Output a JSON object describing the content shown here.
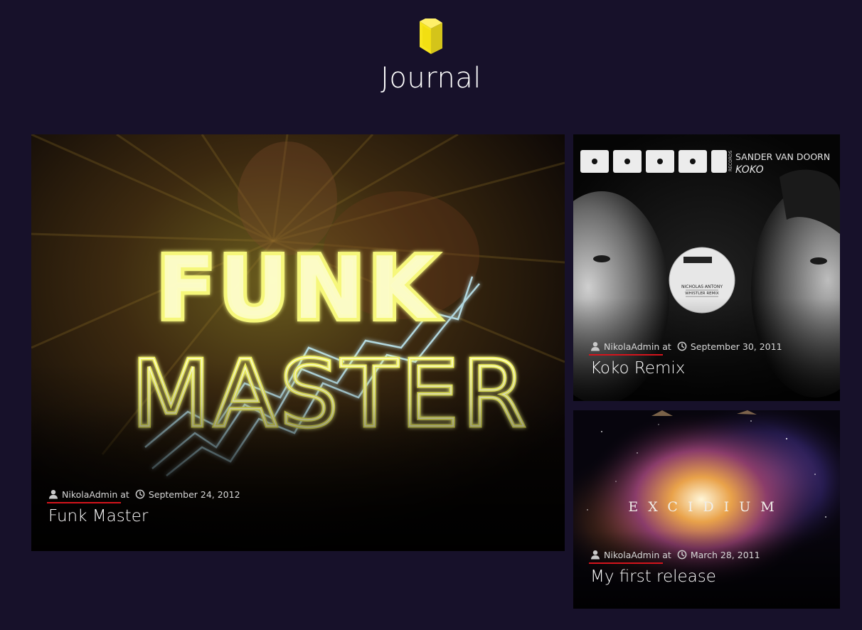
{
  "header": {
    "title": "Journal",
    "icon": "book-icon",
    "icon_color": "#f7e51d"
  },
  "posts": [
    {
      "title": "Funk Master",
      "author": "NikolaAdmin",
      "at_word": "at",
      "date": "September 24, 2012",
      "artwork_text": [
        "FUNK",
        "MASTER"
      ]
    },
    {
      "title": "Koko Remix",
      "author": "NikolaAdmin",
      "at_word": "at",
      "date": "September 30, 2011",
      "artwork_text": [
        "DOORN",
        "RECORDS",
        "SANDER VAN DOORN",
        "KOKO",
        "NICHOLAS ANTONY",
        "WHISTLER REMIX"
      ]
    },
    {
      "title": "My first release",
      "author": "NikolaAdmin",
      "at_word": "at",
      "date": "March 28, 2011",
      "artwork_text": [
        "EXCIDIUM"
      ]
    }
  ],
  "colors": {
    "background": "#17112a",
    "accent_underline": "#d4141c",
    "neon_yellow": "#f8f86a",
    "neon_blue": "#a8e6f2"
  }
}
